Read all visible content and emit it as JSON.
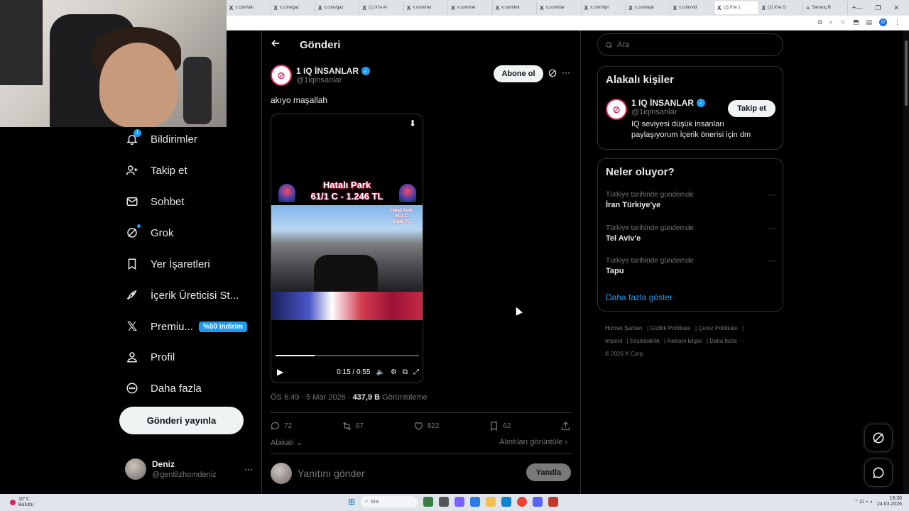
{
  "browser": {
    "tabs": [
      {
        "label": "x.com/talı"
      },
      {
        "label": "x.com/gaz"
      },
      {
        "label": "x.com/gaz"
      },
      {
        "label": "(1) X'te Ar"
      },
      {
        "label": "x.com/ner"
      },
      {
        "label": "x.com/nei"
      },
      {
        "label": "x.com/kol"
      },
      {
        "label": "x.com/dar"
      },
      {
        "label": "x.com/bpt"
      },
      {
        "label": "x.com/ajar"
      },
      {
        "label": "x.com/vid"
      },
      {
        "label": "(1) X'te 1"
      },
      {
        "label": "(1) X'te O"
      },
      {
        "label": "Satranç B"
      }
    ],
    "new_tab": "+",
    "profile_initial": "D"
  },
  "nav": {
    "notifications_badge": "1",
    "items": [
      {
        "label": "Bildirimler",
        "icon": "bell-icon"
      },
      {
        "label": "Takip et",
        "icon": "person-plus-icon"
      },
      {
        "label": "Sohbet",
        "icon": "mail-icon"
      },
      {
        "label": "Grok",
        "icon": "grok-icon"
      },
      {
        "label": "Yer İşaretleri",
        "icon": "bookmark-icon"
      },
      {
        "label": "İçerik Üreticisi St...",
        "icon": "rocket-icon"
      },
      {
        "label": "Premiu...",
        "icon": "x-logo-icon"
      },
      {
        "label": "Profil",
        "icon": "person-icon"
      },
      {
        "label": "Daha fazla",
        "icon": "more-circle-icon"
      }
    ],
    "premium_badge": "%50 indirim",
    "post_button": "Gönderi yayınla",
    "user": {
      "name": "Deniz",
      "handle": "@gentilzhomdeniz"
    }
  },
  "main": {
    "header_title": "Gönderi",
    "author": {
      "name": "1 IQ İNSANLAR",
      "handle": "@1iqinsanlar"
    },
    "subscribe_label": "Abone ol",
    "tweet_text": "akıyo maşallah",
    "video": {
      "title_line1": "Hatalı Park",
      "title_line2": "61/1 C - 1.246 TL",
      "inset_line1": "Hatalı Park",
      "inset_line2": "61/1 C",
      "inset_line3": "1.246 TL",
      "time": "0:15 / 0:55",
      "progress": 0.27
    },
    "meta": {
      "time": "ÖS 6:49 · 5 Mar 2026 · ",
      "views": "437,9 B",
      "views_label": " Görüntüleme"
    },
    "stats": {
      "replies": "72",
      "reposts": "67",
      "likes": "822",
      "bookmarks": "62"
    },
    "related_label": "Alakalı",
    "quotes_label": "Alıntıları görüntüle",
    "reply_placeholder": "Yanıtını gönder",
    "reply_button": "Yanıtla"
  },
  "sidebar": {
    "search_placeholder": "Ara",
    "related_title": "Alakalı kişiler",
    "related_person": {
      "name": "1 IQ İNSANLAR",
      "handle": "@1iqinsanlar",
      "bio": "IQ seviyesi düşük insanları paylaşıyorum İçerik önerisi için dm",
      "follow_label": "Takip et"
    },
    "trends_title": "Neler oluyor?",
    "trends": [
      {
        "context": "Türkiye tarihinde gündemde",
        "name": "İran Türkiye'ye"
      },
      {
        "context": "Türkiye tarihinde gündemde",
        "name": "Tel Aviv'e"
      },
      {
        "context": "Türkiye tarihinde gündemde",
        "name": "Tapu"
      }
    ],
    "show_more": "Daha fazla göster",
    "footer": {
      "terms": "Hizmet Şartları",
      "privacy": "Gizlilik Politikası",
      "cookies": "Çerez Politikası",
      "imprint": "Imprint",
      "accessibility": "Erişilebilirlik",
      "ads": "Reklam bilgisi",
      "more": "Daha fazla ···",
      "copyright": "© 2026 X Corp."
    }
  },
  "taskbar": {
    "weather_temp": "10°C",
    "weather_desc": "Bulutlu",
    "search_label": "Ara",
    "time": "19:30",
    "date": "24.03.2026"
  },
  "colors": {
    "accent": "#1d9bf0",
    "background": "#000000",
    "border": "#2f3336",
    "muted": "#71767b"
  }
}
